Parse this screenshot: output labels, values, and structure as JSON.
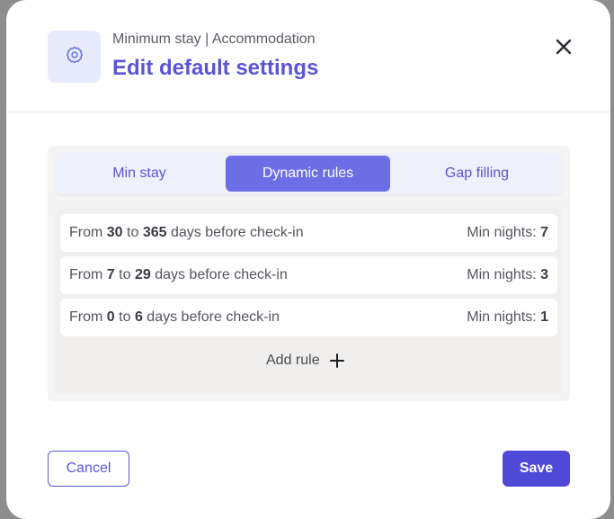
{
  "modal": {
    "subtitle": "Minimum stay | Accommodation",
    "title": "Edit default settings",
    "icon": "gear-icon",
    "accent_color": "#5a55d6"
  },
  "tabs": [
    {
      "label": "Min stay",
      "active": false
    },
    {
      "label": "Dynamic rules",
      "active": true
    },
    {
      "label": "Gap filling",
      "active": false
    }
  ],
  "rules": [
    {
      "prefix": "From",
      "from": "30",
      "to_word": "to",
      "to": "365",
      "suffix": "days before check-in",
      "min_label": "Min nights:",
      "min_value": "7"
    },
    {
      "prefix": "From",
      "from": "7",
      "to_word": "to",
      "to": "29",
      "suffix": "days before check-in",
      "min_label": "Min nights:",
      "min_value": "3"
    },
    {
      "prefix": "From",
      "from": "0",
      "to_word": "to",
      "to": "6",
      "suffix": "days before check-in",
      "min_label": "Min nights:",
      "min_value": "1"
    }
  ],
  "add_rule_label": "Add rule",
  "footer": {
    "cancel_label": "Cancel",
    "save_label": "Save"
  }
}
